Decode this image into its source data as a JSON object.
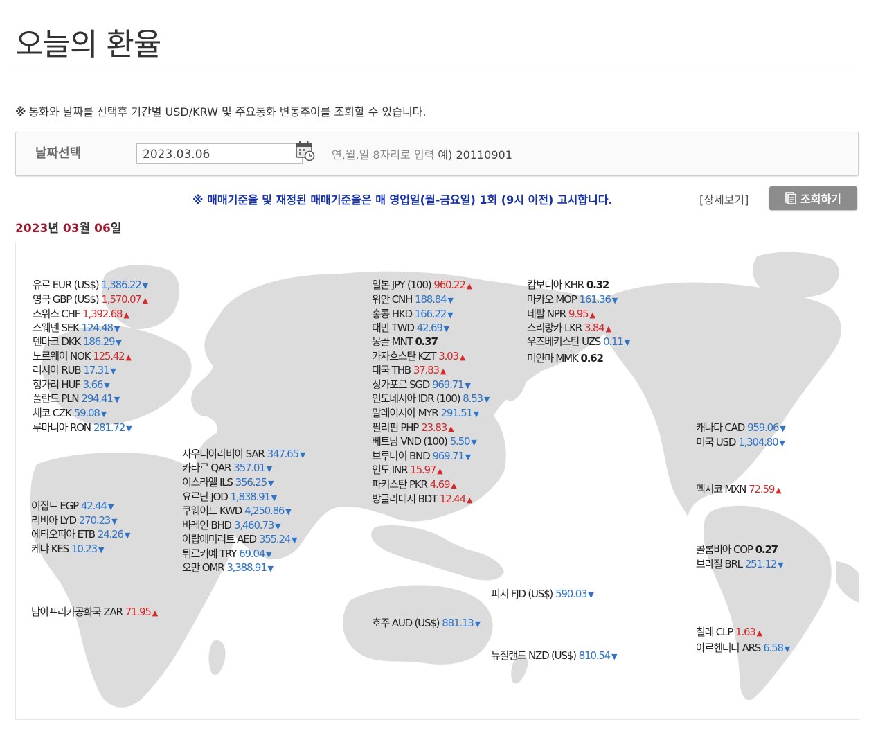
{
  "page": {
    "title": "오늘의 환율"
  },
  "notice": {
    "mark": "※",
    "text": "통화와 날짜를 선택후 기간별 USD/KRW 및 주요통화 변동추이를 조회할 수 있습니다."
  },
  "search": {
    "label": "날짜선택",
    "date_value": "2023.03.06",
    "hint": "연,월,일 8자리로 입력",
    "example": "예) 20110901"
  },
  "info": {
    "text": "※ 매매기준율 및 재정된 매매기준율은 매 영업일(월-금요일) 1회 (9시 이전) 고시합니다.",
    "detail_link": "[상세보기]",
    "query_button": "조회하기"
  },
  "date_heading": {
    "year": "2023",
    "year_suffix": "년",
    "month": "03",
    "month_suffix": "월",
    "day": "06",
    "day_suffix": "일"
  },
  "map": {
    "fill_color": "#dcdcdc",
    "up_color": "#d22a2a",
    "down_color": "#2f73c8",
    "rates": [
      {
        "name": "유로 EUR (US$)",
        "value": "1,386.22",
        "dir": "down"
      },
      {
        "name": "영국 GBP (US$)",
        "value": "1,570.07",
        "dir": "up"
      },
      {
        "name": "스위스 CHF",
        "value": "1,392.68",
        "dir": "up"
      },
      {
        "name": "스웨덴 SEK",
        "value": "124.48",
        "dir": "down"
      },
      {
        "name": "덴마크 DKK",
        "value": "186.29",
        "dir": "down"
      },
      {
        "name": "노르웨이 NOK",
        "value": "125.42",
        "dir": "up"
      },
      {
        "name": "러시아 RUB",
        "value": "17.31",
        "dir": "down"
      },
      {
        "name": "헝가리 HUF",
        "value": "3.66",
        "dir": "down"
      },
      {
        "name": "폴란드 PLN",
        "value": "294.41",
        "dir": "down"
      },
      {
        "name": "체코 CZK",
        "value": "59.08",
        "dir": "down"
      },
      {
        "name": "루마니아 RON",
        "value": "281.72",
        "dir": "down"
      },
      {
        "name": "일본 JPY (100)",
        "value": "960.22",
        "dir": "up"
      },
      {
        "name": "위안 CNH",
        "value": "188.84",
        "dir": "down"
      },
      {
        "name": "홍콩 HKD",
        "value": "166.22",
        "dir": "down"
      },
      {
        "name": "대만 TWD",
        "value": "42.69",
        "dir": "down"
      },
      {
        "name": "몽골 MNT",
        "value": "0.37",
        "dir": "flat"
      },
      {
        "name": "카자흐스탄 KZT",
        "value": "3.03",
        "dir": "up"
      },
      {
        "name": "태국 THB",
        "value": "37.83",
        "dir": "up"
      },
      {
        "name": "싱가포르 SGD",
        "value": "969.71",
        "dir": "down"
      },
      {
        "name": "인도네시아 IDR (100)",
        "value": "8.53",
        "dir": "down"
      },
      {
        "name": "말레이시아 MYR",
        "value": "291.51",
        "dir": "down"
      },
      {
        "name": "필리핀 PHP",
        "value": "23.83",
        "dir": "up"
      },
      {
        "name": "베트남 VND (100)",
        "value": "5.50",
        "dir": "down"
      },
      {
        "name": "브루나이 BND",
        "value": "969.71",
        "dir": "down"
      },
      {
        "name": "인도 INR",
        "value": "15.97",
        "dir": "up"
      },
      {
        "name": "파키스탄 PKR",
        "value": "4.69",
        "dir": "up"
      },
      {
        "name": "방글라데시 BDT",
        "value": "12.44",
        "dir": "up"
      },
      {
        "name": "캄보디아 KHR",
        "value": "0.32",
        "dir": "flat"
      },
      {
        "name": "마카오 MOP",
        "value": "161.36",
        "dir": "down"
      },
      {
        "name": "네팔 NPR",
        "value": "9.95",
        "dir": "up"
      },
      {
        "name": "스리랑카 LKR",
        "value": "3.84",
        "dir": "up"
      },
      {
        "name": "우즈베키스탄 UZS",
        "value": "0.11",
        "dir": "down"
      },
      {
        "name": "미얀마 MMK",
        "value": "0.62",
        "dir": "flat"
      },
      {
        "name": "사우디아라비아 SAR",
        "value": "347.65",
        "dir": "down"
      },
      {
        "name": "카타르 QAR",
        "value": "357.01",
        "dir": "down"
      },
      {
        "name": "이스라엘 ILS",
        "value": "356.25",
        "dir": "down"
      },
      {
        "name": "요르단 JOD",
        "value": "1,838.91",
        "dir": "down"
      },
      {
        "name": "쿠웨이트 KWD",
        "value": "4,250.86",
        "dir": "down"
      },
      {
        "name": "바레인 BHD",
        "value": "3,460.73",
        "dir": "down"
      },
      {
        "name": "아랍에미리트 AED",
        "value": "355.24",
        "dir": "down"
      },
      {
        "name": "튀르키예 TRY",
        "value": "69.04",
        "dir": "down"
      },
      {
        "name": "오만 OMR",
        "value": "3,388.91",
        "dir": "down"
      },
      {
        "name": "이집트 EGP",
        "value": "42.44",
        "dir": "down"
      },
      {
        "name": "리비아 LYD",
        "value": "270.23",
        "dir": "down"
      },
      {
        "name": "에티오피아 ETB",
        "value": "24.26",
        "dir": "down"
      },
      {
        "name": "케냐 KES",
        "value": "10.23",
        "dir": "down"
      },
      {
        "name": "남아프리카공화국 ZAR",
        "value": "71.95",
        "dir": "up"
      },
      {
        "name": "호주 AUD (US$)",
        "value": "881.13",
        "dir": "down"
      },
      {
        "name": "피지 FJD (US$)",
        "value": "590.03",
        "dir": "down"
      },
      {
        "name": "뉴질랜드 NZD (US$)",
        "value": "810.54",
        "dir": "down"
      },
      {
        "name": "캐나다 CAD",
        "value": "959.06",
        "dir": "down"
      },
      {
        "name": "미국 USD",
        "value": "1,304.80",
        "dir": "down"
      },
      {
        "name": "멕시코 MXN",
        "value": "72.59",
        "dir": "up"
      },
      {
        "name": "콜롬비아 COP",
        "value": "0.27",
        "dir": "flat"
      },
      {
        "name": "브라질 BRL",
        "value": "251.12",
        "dir": "down"
      },
      {
        "name": "칠레 CLP",
        "value": "1.63",
        "dir": "up"
      },
      {
        "name": "아르헨티나 ARS",
        "value": "6.58",
        "dir": "down"
      }
    ]
  }
}
